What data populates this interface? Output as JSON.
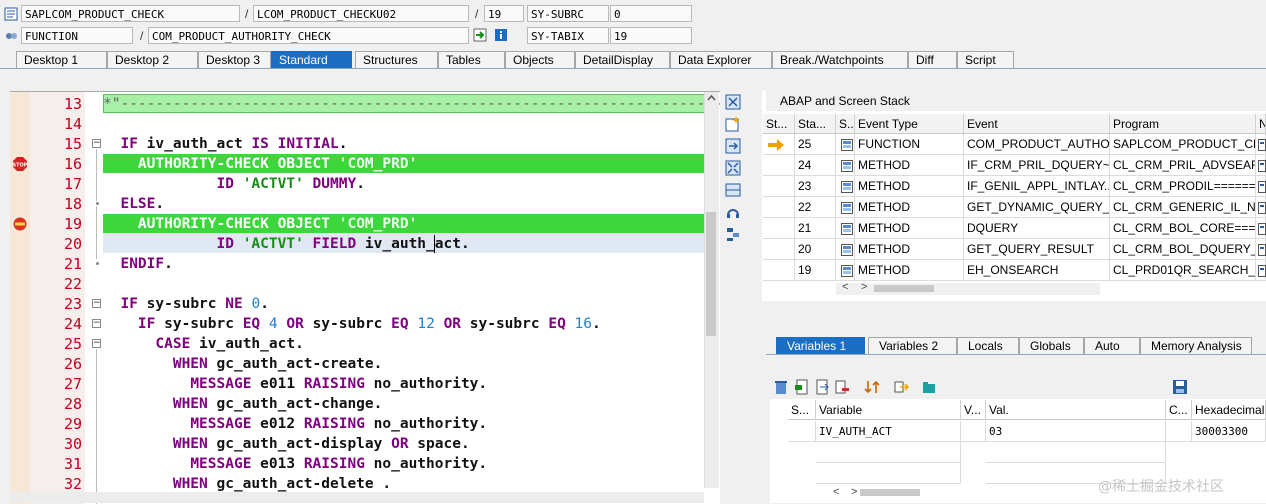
{
  "header": {
    "row1": {
      "program": "SAPLCOM_PRODUCT_CHECK",
      "include": "LCOM_PRODUCT_CHECKU02",
      "line": "19",
      "sysvar": "SY-SUBRC",
      "sysval": "0"
    },
    "row2": {
      "type": "FUNCTION",
      "name": "COM_PRODUCT_AUTHORITY_CHECK",
      "sysvar": "SY-TABIX",
      "sysval": "19"
    },
    "separator": "/"
  },
  "tabs": [
    "Desktop 1",
    "Desktop 2",
    "Desktop 3",
    "Standard",
    "Structures",
    "Tables",
    "Objects",
    "DetailDisplay",
    "Data Explorer",
    "Break./Watchpoints",
    "Diff",
    "Script"
  ],
  "active_tab": "Standard",
  "code_lines": [
    {
      "n": "13",
      "text": "*\"--------------------------------------------------------------------------"
    },
    {
      "n": "14",
      "text": ""
    },
    {
      "n": "15",
      "text": "  IF iv_auth_act IS INITIAL."
    },
    {
      "n": "16",
      "text": "    AUTHORITY-CHECK OBJECT 'COM_PRD'"
    },
    {
      "n": "17",
      "text": "             ID 'ACTVT' DUMMY."
    },
    {
      "n": "18",
      "text": "  ELSE."
    },
    {
      "n": "19",
      "text": "    AUTHORITY-CHECK OBJECT 'COM_PRD'"
    },
    {
      "n": "20",
      "text": "             ID 'ACTVT' FIELD iv_auth_act."
    },
    {
      "n": "21",
      "text": "  ENDIF."
    },
    {
      "n": "22",
      "text": ""
    },
    {
      "n": "23",
      "text": "  IF sy-subrc NE 0."
    },
    {
      "n": "24",
      "text": "    IF sy-subrc EQ 4 OR sy-subrc EQ 12 OR sy-subrc EQ 16."
    },
    {
      "n": "25",
      "text": "      CASE iv_auth_act."
    },
    {
      "n": "26",
      "text": "        WHEN gc_auth_act-create."
    },
    {
      "n": "27",
      "text": "          MESSAGE e011 RAISING no_authority."
    },
    {
      "n": "28",
      "text": "        WHEN gc_auth_act-change."
    },
    {
      "n": "29",
      "text": "          MESSAGE e012 RAISING no_authority."
    },
    {
      "n": "30",
      "text": "        WHEN gc_auth_act-display OR space."
    },
    {
      "n": "31",
      "text": "          MESSAGE e013 RAISING no_authority."
    },
    {
      "n": "32",
      "text": "        WHEN gc_auth_act-delete ."
    }
  ],
  "stack": {
    "title": "ABAP and Screen Stack",
    "columns": [
      "St...",
      "Sta...",
      "S...",
      "Event Type",
      "Event",
      "Program",
      "N"
    ],
    "rows": [
      {
        "level": "25",
        "type": "FUNCTION",
        "event": "COM_PRODUCT_AUTHO...",
        "program": "SAPLCOM_PRODUCT_CH...",
        "current": true
      },
      {
        "level": "24",
        "type": "METHOD",
        "event": "IF_CRM_PRIL_DQUERY~...",
        "program": "CL_CRM_PRIL_ADVSEAR...",
        "current": false
      },
      {
        "level": "23",
        "type": "METHOD",
        "event": "IF_GENIL_APPL_INTLAY...",
        "program": "CL_CRM_PRODIL======...",
        "current": false
      },
      {
        "level": "22",
        "type": "METHOD",
        "event": "GET_DYNAMIC_QUERY_...",
        "program": "CL_CRM_GENERIC_IL_NE...",
        "current": false
      },
      {
        "level": "21",
        "type": "METHOD",
        "event": "DQUERY",
        "program": "CL_CRM_BOL_CORE====...",
        "current": false
      },
      {
        "level": "20",
        "type": "METHOD",
        "event": "GET_QUERY_RESULT",
        "program": "CL_CRM_BOL_DQUERY_...",
        "current": false
      },
      {
        "level": "19",
        "type": "METHOD",
        "event": "EH_ONSEARCH",
        "program": "CL_PRD01QR_SEARCH_I...",
        "current": false
      }
    ]
  },
  "var_tabs": [
    "Variables 1",
    "Variables 2",
    "Locals",
    "Globals",
    "Auto",
    "Memory Analysis"
  ],
  "active_var_tab": "Variables 1",
  "variables": {
    "columns": [
      "S...",
      "Variable",
      "V...",
      "Val.",
      "C...",
      "Hexadecimal"
    ],
    "rows": [
      {
        "name": "IV_AUTH_ACT",
        "value": "03",
        "hex": "30003300"
      }
    ]
  },
  "watermark": "@稀土掘金技术社区"
}
